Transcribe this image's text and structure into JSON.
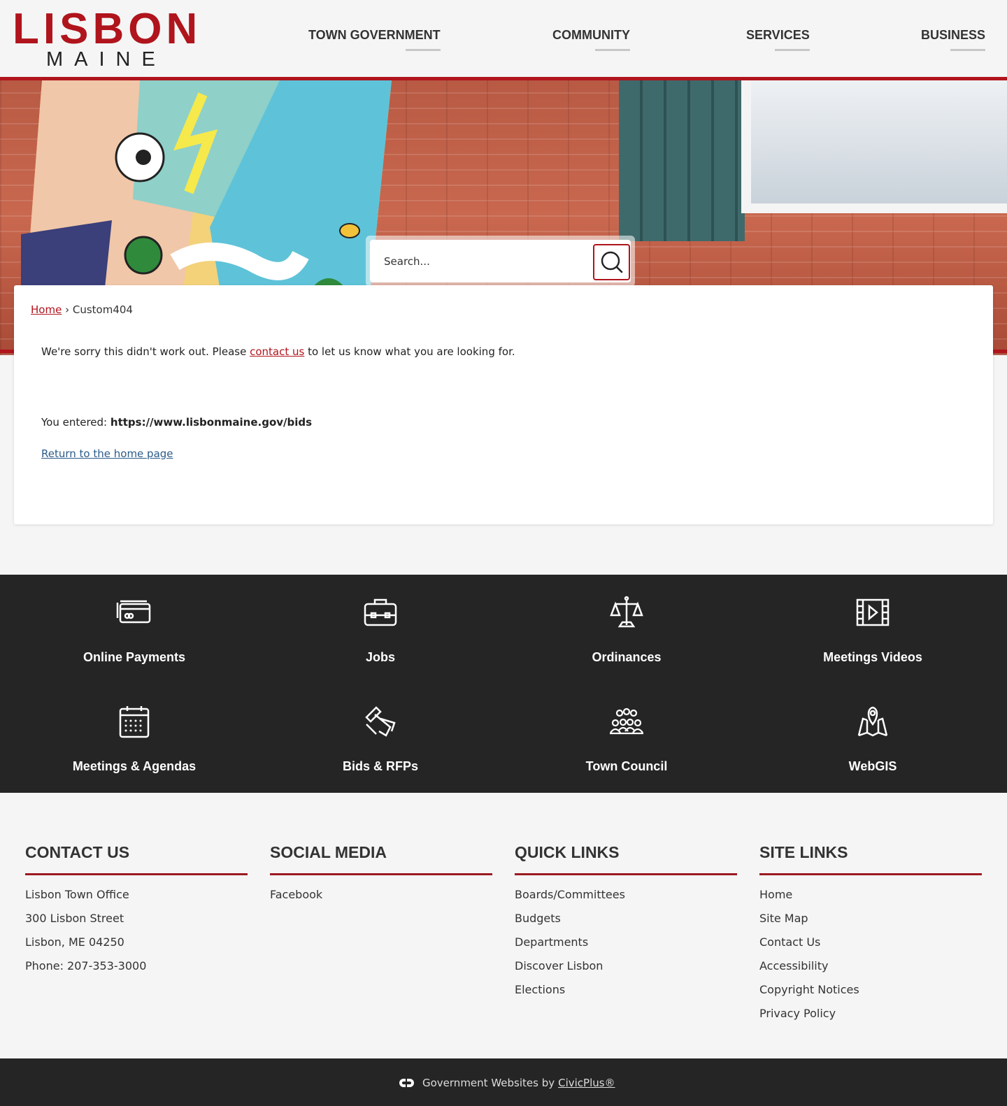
{
  "header": {
    "logo_top": "LISBON",
    "logo_bottom": "MAINE",
    "nav": [
      "TOWN GOVERNMENT",
      "COMMUNITY",
      "SERVICES",
      "BUSINESS"
    ]
  },
  "search": {
    "placeholder": "Search..."
  },
  "breadcrumb": {
    "home": "Home",
    "separator": "›",
    "current": "Custom404"
  },
  "message": {
    "before_link": "We're sorry this didn't work out. Please ",
    "link": "contact us",
    "after_link": " to let us know what you are looking for.",
    "entered_label": "You entered: ",
    "entered_url": "https://www.lisbonmaine.gov/bids",
    "return_link": "Return to the home page"
  },
  "quick_links": [
    {
      "label": "Online Payments",
      "icon": "credit-card-icon"
    },
    {
      "label": "Jobs",
      "icon": "briefcase-icon"
    },
    {
      "label": "Ordinances",
      "icon": "scales-icon"
    },
    {
      "label": "Meetings Videos",
      "icon": "video-film-icon"
    },
    {
      "label": "Meetings & Agendas",
      "icon": "calendar-icon"
    },
    {
      "label": "Bids & RFPs",
      "icon": "hand-document-icon"
    },
    {
      "label": "Town Council",
      "icon": "group-people-icon"
    },
    {
      "label": "WebGIS",
      "icon": "map-pin-icon"
    }
  ],
  "footer": {
    "contact": {
      "title": "CONTACT US",
      "lines": [
        "Lisbon Town Office",
        "300 Lisbon Street",
        "Lisbon, ME 04250",
        "Phone: 207-353-3000"
      ]
    },
    "social": {
      "title": "SOCIAL MEDIA",
      "links": [
        "Facebook"
      ]
    },
    "quick": {
      "title": "QUICK LINKS",
      "links": [
        "Boards/Committees",
        "Budgets",
        "Departments",
        "Discover Lisbon",
        "Elections"
      ]
    },
    "site": {
      "title": "SITE LINKS",
      "links": [
        "Home",
        "Site Map",
        "Contact Us",
        "Accessibility",
        "Copyright Notices",
        "Privacy Policy"
      ]
    }
  },
  "bottom": {
    "text": "Government Websites by",
    "link": "CivicPlus®"
  },
  "colors": {
    "brand_red": "#b0141c",
    "dark_band": "#252525"
  }
}
